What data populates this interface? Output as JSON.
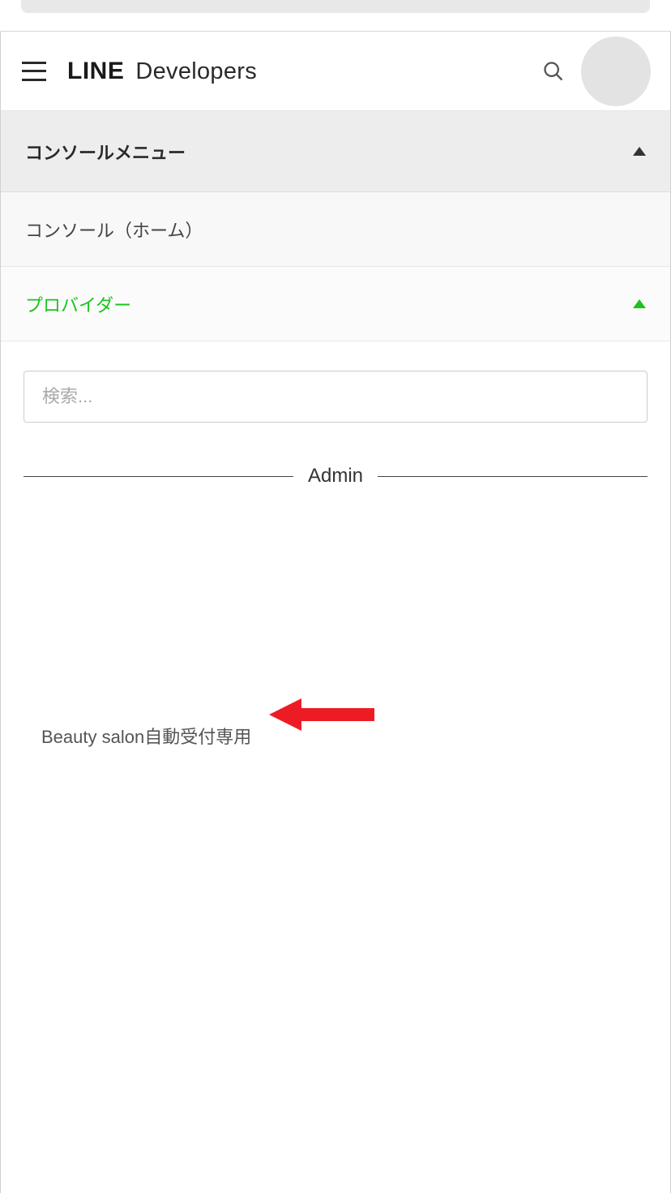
{
  "header": {
    "logo_line": "LINE",
    "logo_dev": "Developers"
  },
  "console_menu": {
    "label": "コンソールメニュー",
    "expanded": true
  },
  "nav": {
    "console_home": "コンソール（ホーム）",
    "provider": "プロバイダー"
  },
  "search": {
    "placeholder": "検索..."
  },
  "section": {
    "admin_label": "Admin"
  },
  "providers": [
    {
      "name": "Beauty salon自動受付専用"
    }
  ],
  "colors": {
    "accent": "#1bc41b",
    "annotation": "#ed1c24"
  }
}
